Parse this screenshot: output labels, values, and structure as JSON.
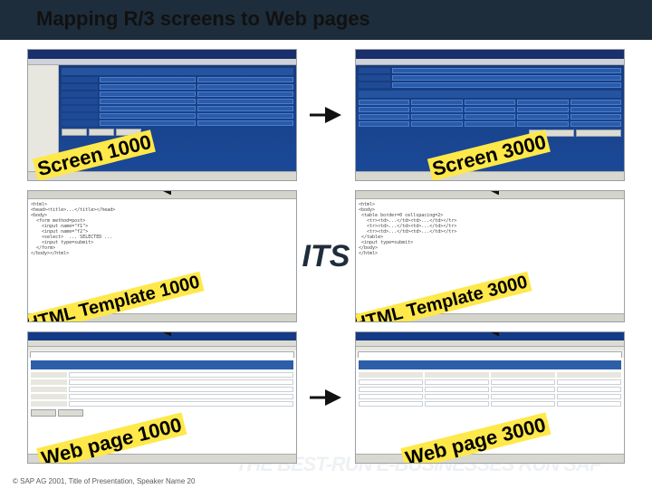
{
  "header": {
    "title": "Mapping R/3 screens to Web pages"
  },
  "labels": {
    "screen_left": "Screen 1000",
    "screen_right": "Screen 3000",
    "tmpl_left": "HTML Template 1000",
    "tmpl_right": "HTML Template 3000",
    "page_left": "Web page 1000",
    "page_right": "Web page 3000"
  },
  "center": {
    "its": "ITS"
  },
  "bg": {
    "top": "THE BEST-RUN             E-BUS",
    "bot": "THE BEST-RUN  E-BUSINESSES RUN SAP"
  },
  "footer": {
    "copyright": "© SAP AG 2001, Title of Presentation, Speaker Name  20"
  }
}
